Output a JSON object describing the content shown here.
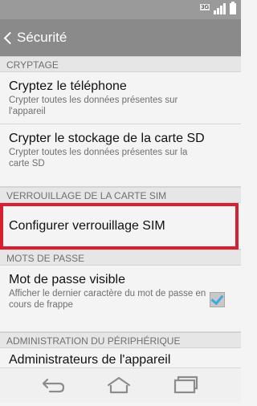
{
  "status_bar": {
    "network_badge": "3G"
  },
  "action_bar": {
    "title": "Sécurité"
  },
  "sections": {
    "encryption": {
      "header": "CRYPTAGE",
      "encrypt_phone": {
        "title": "Cryptez le téléphone",
        "subtitle": "Crypter toutes les données présentes sur l'appareil"
      },
      "encrypt_sd": {
        "title": "Crypter le stockage de la carte SD",
        "subtitle": "Crypter toutes les données présentes sur la carte SD"
      }
    },
    "sim_lock": {
      "header": "VERROUILLAGE DE LA CARTE SIM",
      "configure": {
        "title": "Configurer verrouillage SIM"
      }
    },
    "passwords": {
      "header": "MOTS DE PASSE",
      "visible_password": {
        "title": "Mot de passe visible",
        "subtitle": "Afficher le dernier caractère du mot de passe en cours de frappe",
        "checked": true
      }
    },
    "device_admin": {
      "header": "ADMINISTRATION DU PÉRIPHÉRIQUE",
      "administrators": {
        "title": "Administrateurs de l'appareil"
      }
    }
  },
  "icons": {
    "back": "chevron-left-icon",
    "nav_back": "back-arrow-icon",
    "nav_home": "home-icon",
    "nav_recent": "recent-apps-icon"
  },
  "colors": {
    "highlight": "#d7202f",
    "checkbox_check": "#3fa7e0",
    "action_bar": "#8a8a8a"
  }
}
